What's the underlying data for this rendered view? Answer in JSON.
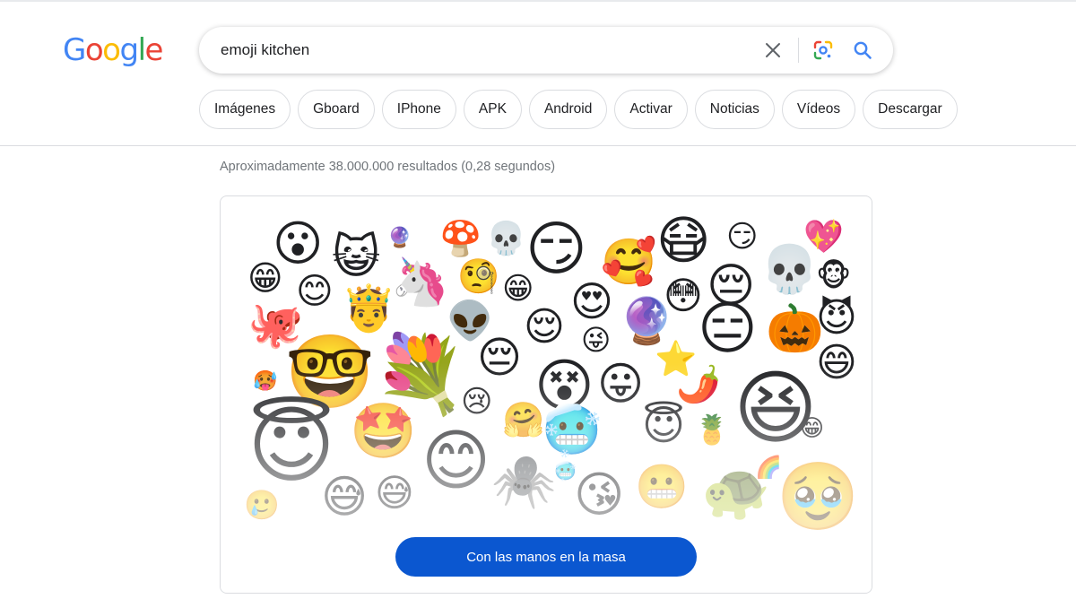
{
  "logo": {
    "letters": [
      "G",
      "o",
      "o",
      "g",
      "l",
      "e"
    ],
    "colors": [
      "#4285F4",
      "#EA4335",
      "#FBBC05",
      "#4285F4",
      "#34A853",
      "#EA4335"
    ]
  },
  "search": {
    "query": "emoji kitchen",
    "clear_icon": "close-icon",
    "lens_icon": "google-lens-icon",
    "search_icon": "search-icon"
  },
  "chips": [
    "Imágenes",
    "Gboard",
    "IPhone",
    "APK",
    "Android",
    "Activar",
    "Noticias",
    "Vídeos",
    "Descargar"
  ],
  "result_stats": "Aproximadamente 38.000.000 resultados (0,28 segundos)",
  "emoji_card": {
    "button_label": "Con las manos en la masa",
    "button_color": "#0b57d0",
    "emojis": [
      "😮",
      "😺",
      "🔮",
      "🍄",
      "💀",
      "😏",
      "🥰",
      "😷",
      "😏",
      "💖",
      "😁",
      "😊",
      "🦄",
      "🧐",
      "😁",
      "😍",
      "😳",
      "😔",
      "💀",
      "🐵",
      "🐙",
      "🤴",
      "👽",
      "😌",
      "😜",
      "🔮",
      "😑",
      "🎃",
      "😈",
      "🤓",
      "💐",
      "😔",
      "😵",
      "😛",
      "⭐",
      "🌶️",
      "😆",
      "😄",
      "🥵",
      "😢",
      "🤗",
      "🥶",
      "😇",
      "🍍",
      "😁",
      "😇",
      "🤩",
      "😊",
      "🕷️",
      "🥶",
      "😘",
      "😬",
      "🐢",
      "🌈",
      "🥹",
      "🥲",
      "😅",
      "😅"
    ]
  }
}
